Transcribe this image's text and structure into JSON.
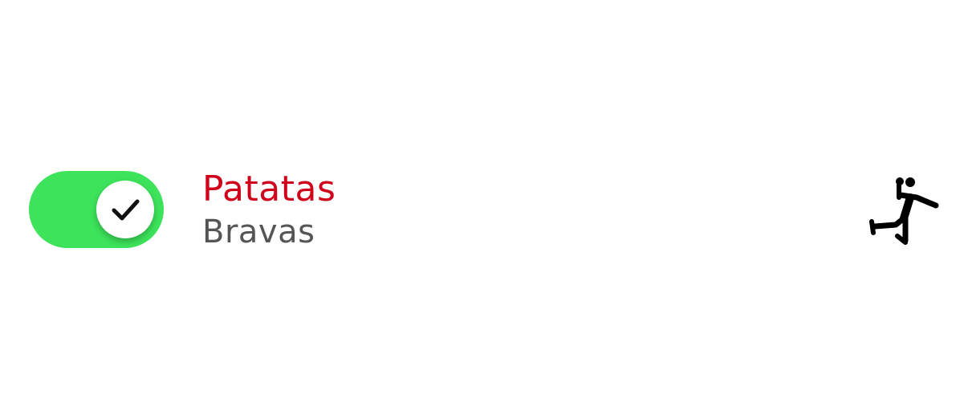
{
  "list_item": {
    "toggle": {
      "state": "on",
      "accent_color": "#3de35a",
      "knob_icon": "check-icon"
    },
    "title": "Patatas",
    "subtitle": "Bravas",
    "title_color": "#d0021b",
    "subtitle_color": "#555555",
    "trailing_icon": "handball-player-icon"
  }
}
